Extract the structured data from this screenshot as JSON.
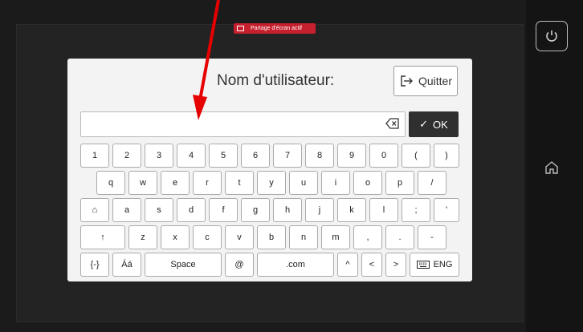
{
  "badge": {
    "text": "Partage d'écran actif"
  },
  "dialog": {
    "title": "Nom d'utilisateur:",
    "quit_label": "Quitter",
    "input_value": "",
    "ok_label": "OK"
  },
  "keyboard": {
    "row1": [
      "1",
      "2",
      "3",
      "4",
      "5",
      "6",
      "7",
      "8",
      "9",
      "0",
      "(",
      ")"
    ],
    "row2": [
      "q",
      "w",
      "e",
      "r",
      "t",
      "y",
      "u",
      "i",
      "o",
      "p",
      "/"
    ],
    "row3": [
      "⌂",
      "a",
      "s",
      "d",
      "f",
      "g",
      "h",
      "j",
      "k",
      "l",
      ";",
      "'"
    ],
    "row4": [
      "↑",
      "z",
      "x",
      "c",
      "v",
      "b",
      "n",
      "m",
      ",",
      ".",
      "-"
    ],
    "row5": [
      "{-}",
      "Áá",
      "Space",
      "@",
      ".com",
      "^",
      "<",
      ">",
      "ENG"
    ]
  },
  "accent_color": "#c6202e"
}
